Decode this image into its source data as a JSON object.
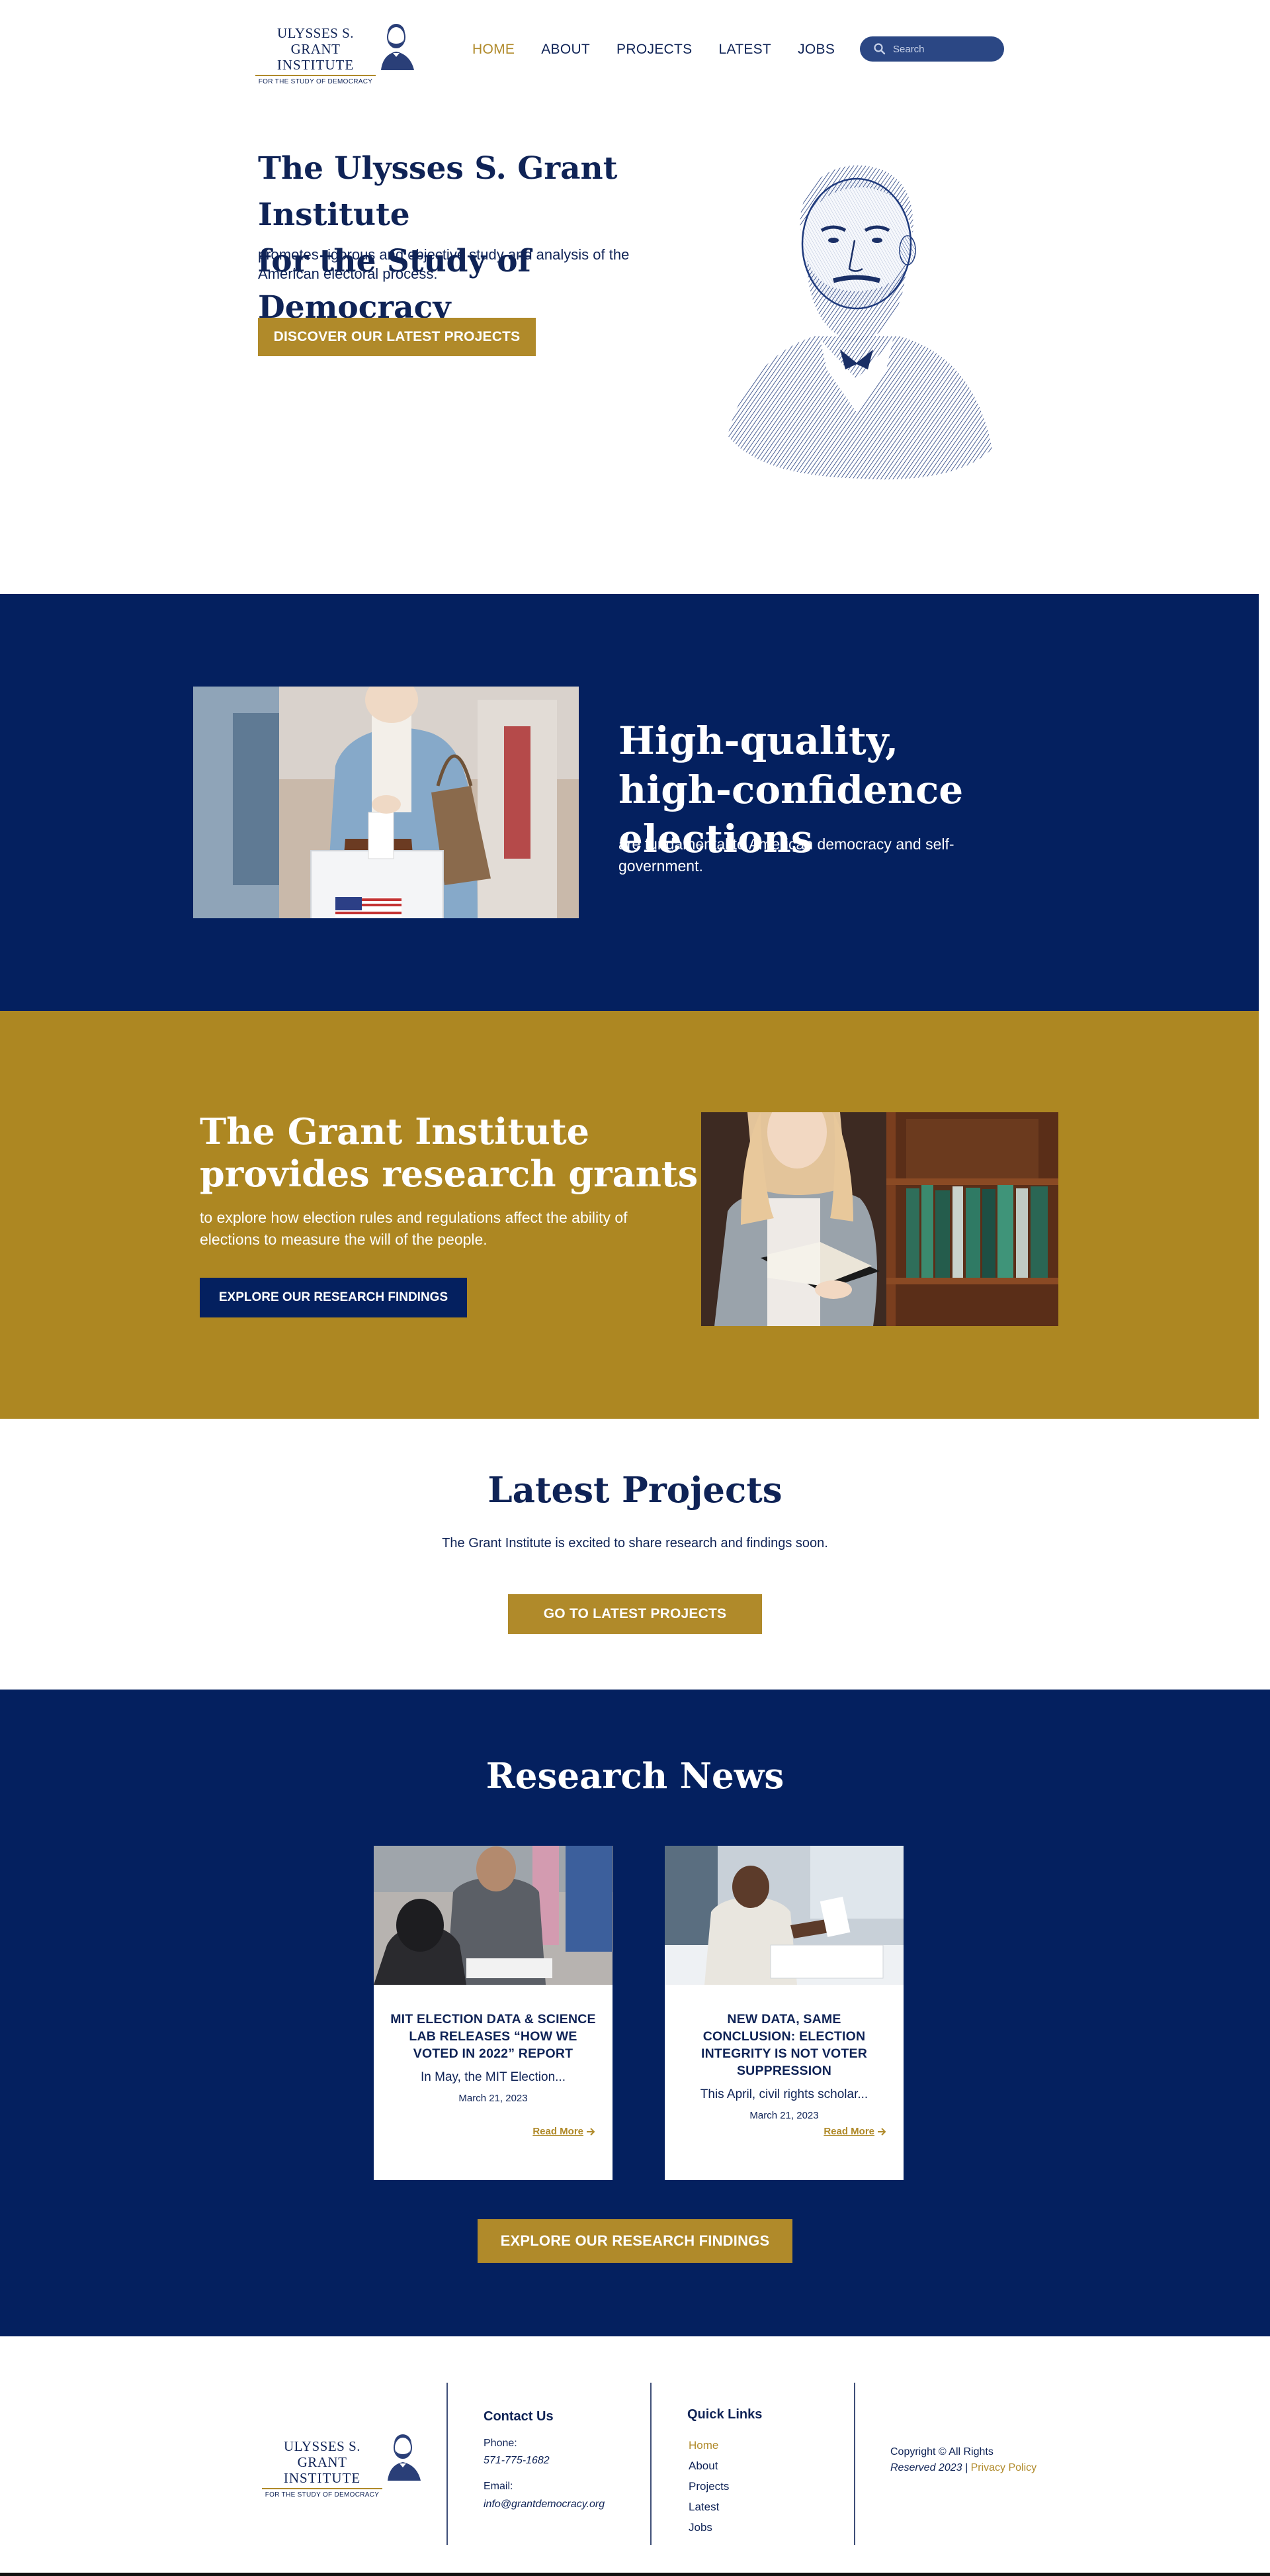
{
  "header": {
    "logo": {
      "line1": "ULYSSES S. GRANT",
      "line2": "INSTITUTE",
      "line3": "FOR THE STUDY OF DEMOCRACY"
    },
    "nav": [
      {
        "label": "HOME",
        "active": true
      },
      {
        "label": "ABOUT",
        "active": false
      },
      {
        "label": "PROJECTS",
        "active": false
      },
      {
        "label": "LATEST",
        "active": false
      },
      {
        "label": "JOBS",
        "active": false
      }
    ],
    "search": {
      "placeholder": "Search",
      "icon": "search-icon"
    }
  },
  "hero": {
    "title_line1": "The Ulysses S. Grant Institute",
    "title_line2": "for the Study of Democracy",
    "subtitle": "promotes rigorous and objective study and analysis of the American electoral process.",
    "button": "DISCOVER OUR LATEST PROJECTS"
  },
  "elections": {
    "title_line1": "High-quality,",
    "title_line2": "high-confidence elections",
    "subtitle": "are fundamental to American democracy and self-government."
  },
  "grants": {
    "title": "The Grant Institute provides research grants",
    "subtitle": "to explore how election rules and regulations affect the ability of elections to measure the will of the people.",
    "button": "EXPLORE OUR RESEARCH FINDINGS"
  },
  "latest": {
    "title": "Latest Projects",
    "subtitle": "The Grant Institute is excited to share research and findings soon.",
    "button": "GO TO LATEST PROJECTS"
  },
  "news": {
    "title": "Research News",
    "cards": [
      {
        "title": "MIT ELECTION DATA & SCIENCE LAB RELEASES “HOW WE VOTED IN 2022” REPORT",
        "excerpt": "In May, the MIT Election...",
        "date": "March 21, 2023",
        "read_more": "Read More"
      },
      {
        "title": "NEW DATA, SAME CONCLUSION: ELECTION INTEGRITY IS NOT VOTER SUPPRESSION",
        "excerpt": "This April, civil rights scholar...",
        "date": "March 21, 2023",
        "read_more": "Read More"
      }
    ],
    "button": "EXPLORE OUR RESEARCH FINDINGS"
  },
  "footer": {
    "contact": {
      "heading": "Contact Us",
      "phone_label": "Phone:",
      "phone": "571-775-1682",
      "email_label": "Email:",
      "email": "info@grantdemocracy.org"
    },
    "quick_links": {
      "heading": "Quick Links",
      "links": [
        "Home",
        "About",
        "Projects",
        "Latest",
        "Jobs"
      ]
    },
    "copyright_line1": "Copyright © All Rights",
    "copyright_line2": "Reserved 2023 |",
    "privacy": "Privacy Policy"
  },
  "colors": {
    "navy": "#04205f",
    "gold": "#ad8722",
    "accent_gold": "#b08a2a",
    "text_navy": "#0f2356",
    "search_bg": "#2b4784"
  }
}
